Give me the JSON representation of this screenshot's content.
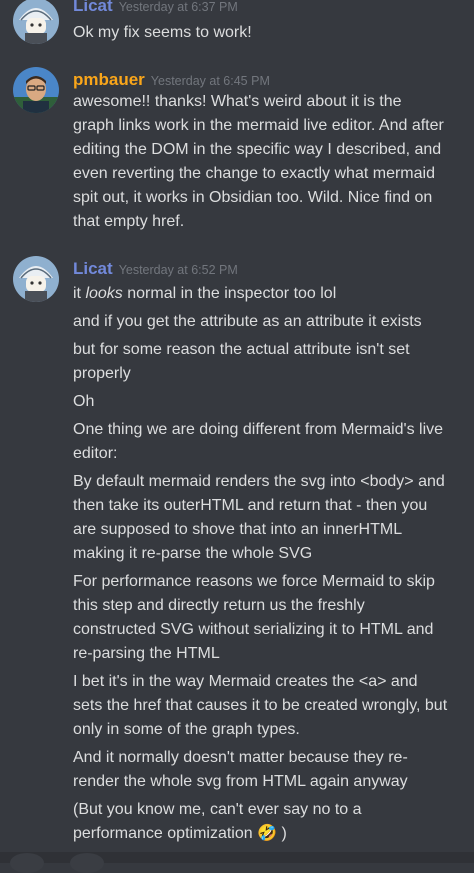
{
  "colors": {
    "background": "#36393f",
    "licat_name": "#7289da",
    "pmbauer_name": "#faa61a",
    "timestamp": "#72767d",
    "text": "#dcddde"
  },
  "messages": [
    {
      "author": "Licat",
      "timestamp": "Yesterday at 6:37 PM",
      "avatar_icon": "licat-avatar",
      "lines": [
        "Ok my fix seems to work!"
      ]
    },
    {
      "author": "pmbauer",
      "timestamp": "Yesterday at 6:45 PM",
      "avatar_icon": "pmbauer-avatar",
      "lines": [
        "awesome!! thanks! What's weird about it is the",
        "graph links work in the mermaid live editor. And after",
        "editing the DOM in the specific way I described, and",
        "even reverting the change to exactly what mermaid",
        "spit out, it works in Obsidian too. Wild. Nice find on",
        "that empty href."
      ]
    },
    {
      "author": "Licat",
      "timestamp": "Yesterday at 6:52 PM",
      "avatar_icon": "licat-avatar",
      "lines": {
        "l1_pre": "it ",
        "l1_em": "looks",
        "l1_post": " normal in the inspector too lol",
        "l2": "and if you get the attribute as an attribute it exists",
        "l3": "but for some reason the actual attribute isn't set",
        "l4": "properly",
        "l5": "Oh",
        "l6": "One thing we are doing different from Mermaid's live",
        "l7": "editor:",
        "l8": "By default mermaid renders the svg into <body> and",
        "l9": "then take its outerHTML and return that - then you",
        "l10": "are supposed to shove that into an innerHTML",
        "l11": "making it re-parse the whole SVG",
        "l12": "For performance reasons we force Mermaid to skip",
        "l13": "this step and directly return us the freshly",
        "l14": "constructed SVG without serializing it to HTML and",
        "l15": "re-parsing the HTML",
        "l16": "I bet it's in the way Mermaid creates the <a> and",
        "l17": "sets the href that causes it to be created wrongly, but",
        "l18": "only in some of the graph types.",
        "l19": "And it normally doesn't matter because they re-",
        "l20": "render the whole svg from HTML again anyway",
        "l21": "(But you know me, can't ever say no to a",
        "l22_pre": "performance optimization ",
        "l22_emoji": "🤣",
        "l22_post": " )"
      }
    }
  ]
}
